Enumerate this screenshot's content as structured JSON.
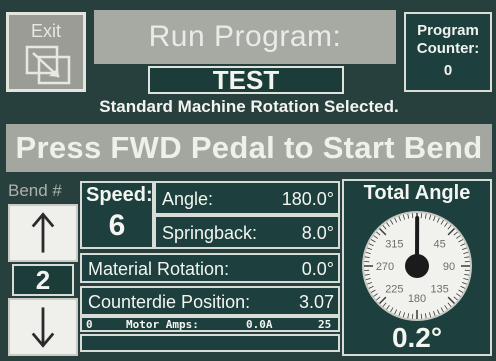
{
  "header": {
    "exit_label": "Exit",
    "title": "Run Program:",
    "program_name": "TEST",
    "counter_label_1": "Program",
    "counter_label_2": "Counter:",
    "counter_value": "0"
  },
  "status": {
    "rotation": "Standard Machine Rotation Selected."
  },
  "instruction": "Press FWD Pedal to Start Bend",
  "bend": {
    "label": "Bend #",
    "value": "2"
  },
  "speed": {
    "label": "Speed:",
    "value": "6"
  },
  "angle": {
    "label": "Angle:",
    "value": "180.0°"
  },
  "springback": {
    "label": "Springback:",
    "value": "8.0°"
  },
  "material_rotation": {
    "label": "Material Rotation:",
    "value": "0.0°"
  },
  "counterdie": {
    "label": "Counterdie Position:",
    "value": "3.07"
  },
  "motor": {
    "min": "0",
    "label": "Motor Amps:",
    "value": "0.0A",
    "max": "25",
    "level_fraction": 0.0
  },
  "total_angle": {
    "title": "Total Angle",
    "value": "0.2°",
    "dial_labels": [
      "315",
      "45",
      "270",
      "90",
      "225",
      "135",
      "180"
    ],
    "needle_degrees": 0.2
  },
  "colors": {
    "panel_bg": "#1d3f3d",
    "gray_bar": "#a6aaa3",
    "text": "#f3f5f0"
  }
}
